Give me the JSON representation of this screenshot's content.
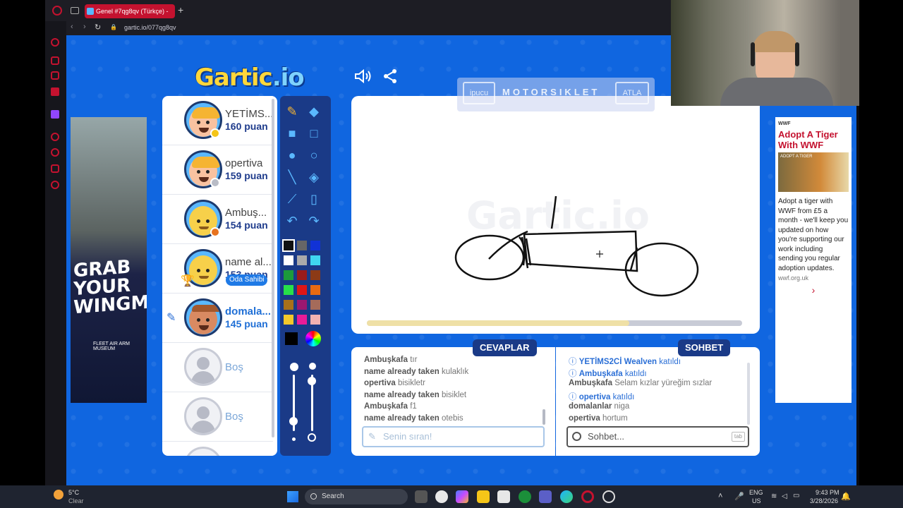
{
  "browser": {
    "tab_title": "Genel #7qg8qv (Türkçe) - ",
    "url": "gartic.io/077qg8qv",
    "new_tab_glyph": "+",
    "nav_back_glyph": "‹",
    "nav_forward_glyph": "›",
    "reload_glyph": "↻",
    "lock_glyph": "🔒"
  },
  "game": {
    "logo_main": "Gartic",
    "logo_suffix": ".io",
    "hint": {
      "hint_button": "ipucu",
      "word": "MOTORSIKLET",
      "skip_button": "ATLA"
    },
    "progress": 0.7,
    "players": [
      {
        "name": "YETİMS...",
        "score": "160 puan",
        "status_color": "#f5c518"
      },
      {
        "name": "opertiva",
        "score": "159 puan",
        "status_color": "#b9bcc6"
      },
      {
        "name": "Ambuş...",
        "score": "154 puan",
        "status_color": "#e8731f"
      },
      {
        "name": "name al...",
        "score": "153 puan",
        "owner_badge": "Oda Sahibi"
      },
      {
        "name": "domala...",
        "score": "145 puan",
        "drawing": true
      },
      {
        "name": "Boş"
      },
      {
        "name": "Boş"
      }
    ],
    "colors": [
      "#111111",
      "#666666",
      "#1132d6",
      "#ffffff",
      "#aaaaaa",
      "#3fd7f0",
      "#1c9a3b",
      "#9a1b1b",
      "#8c3a16",
      "#27e04a",
      "#e01616",
      "#e86a12",
      "#a8701a",
      "#9b1770",
      "#a56b5a",
      "#f4c82a",
      "#ea1c98",
      "#f3b1b1"
    ],
    "selected_color": "#000000",
    "answers": {
      "label": "CEVAPLAR",
      "messages": [
        {
          "user": "Ambuşkafa",
          "text": "tır"
        },
        {
          "user": "name already taken",
          "text": "kulaklık"
        },
        {
          "user": "opertiva",
          "text": "bisikletr"
        },
        {
          "user": "name already taken",
          "text": "bisiklet"
        },
        {
          "user": "Ambuşkafa",
          "text": "f1"
        },
        {
          "user": "name already taken",
          "text": "otebis"
        }
      ],
      "placeholder": "Senin sıran!"
    },
    "chat": {
      "label": "SOHBET",
      "messages": [
        {
          "user": "YETİMS2Cİ Wealven",
          "text": "katıldı",
          "system": true
        },
        {
          "user": "Ambuşkafa",
          "text": "katıldı",
          "system": true
        },
        {
          "user": "Ambuşkafa",
          "text": "Selam kızlar yüreğim sızlar"
        },
        {
          "user": "opertiva",
          "text": "katıldı",
          "system": true
        },
        {
          "user": "domalanlar",
          "text": "niga"
        },
        {
          "user": "opertiva",
          "text": "hortum"
        }
      ],
      "placeholder": "Sohbet...",
      "tab_hint": "tab"
    }
  },
  "ads": {
    "left": {
      "headline": "GRAB YOUR WINGMAN",
      "sub": "FLEET AIR ARM MUSEUM"
    },
    "right": {
      "brand": "WWF",
      "headline": "Adopt A Tiger With WWF",
      "image_caption": "ADOPT A TIGER",
      "body": "Adopt a tiger with WWF from £5 a month - we'll keep you updated on how you're supporting our work including sending you regular adoption updates.",
      "link": "wwf.org.uk",
      "chevron": "›"
    }
  },
  "taskbar": {
    "weather_temp": "5°C",
    "weather_desc": "Clear",
    "search_label": "Search",
    "lang_top": "ENG",
    "lang_bottom": "US",
    "time": "9:43 PM",
    "date": "3/28/2026"
  }
}
